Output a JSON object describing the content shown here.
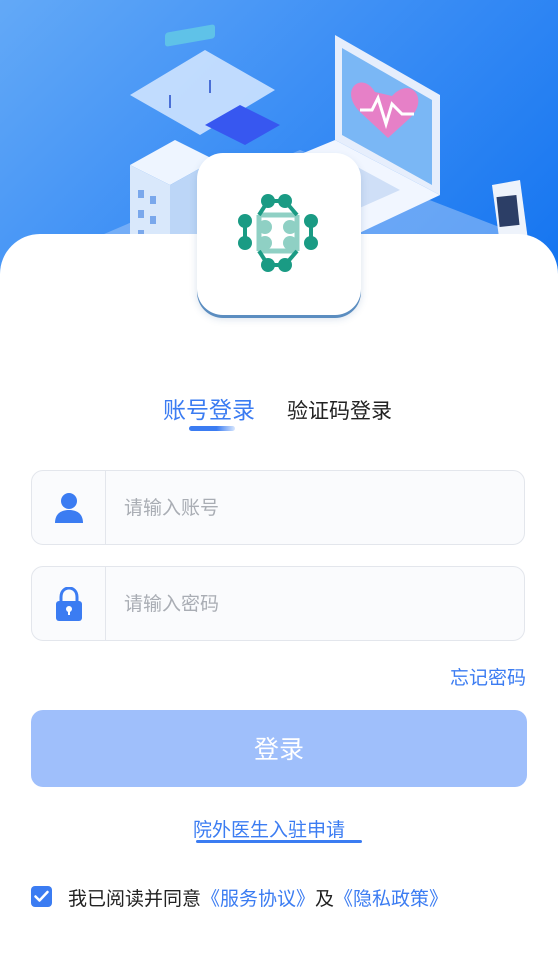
{
  "hero": {
    "illustration": "medical-isometric-illustration"
  },
  "logo": {
    "icon": "molecule-logo-icon",
    "accent": "#1a9b84"
  },
  "tabs": [
    {
      "label": "账号登录",
      "active": true
    },
    {
      "label": "验证码登录",
      "active": false
    }
  ],
  "form": {
    "account": {
      "placeholder": "请输入账号",
      "value": "",
      "icon": "user-icon"
    },
    "password": {
      "placeholder": "请输入密码",
      "value": "",
      "icon": "lock-icon"
    },
    "forgot_label": "忘记密码",
    "login_label": "登录",
    "apply_label": "院外医生入驻申请"
  },
  "agreement": {
    "checked": true,
    "prefix": "我已阅读并同意",
    "service_link": "《服务协议》",
    "joiner": "及",
    "privacy_link": "《隐私政策》"
  },
  "colors": {
    "accent": "#3b7cf2",
    "button_disabled": "#9fbffb",
    "hero_gradient": [
      "#63a9f7",
      "#1273f0"
    ]
  }
}
